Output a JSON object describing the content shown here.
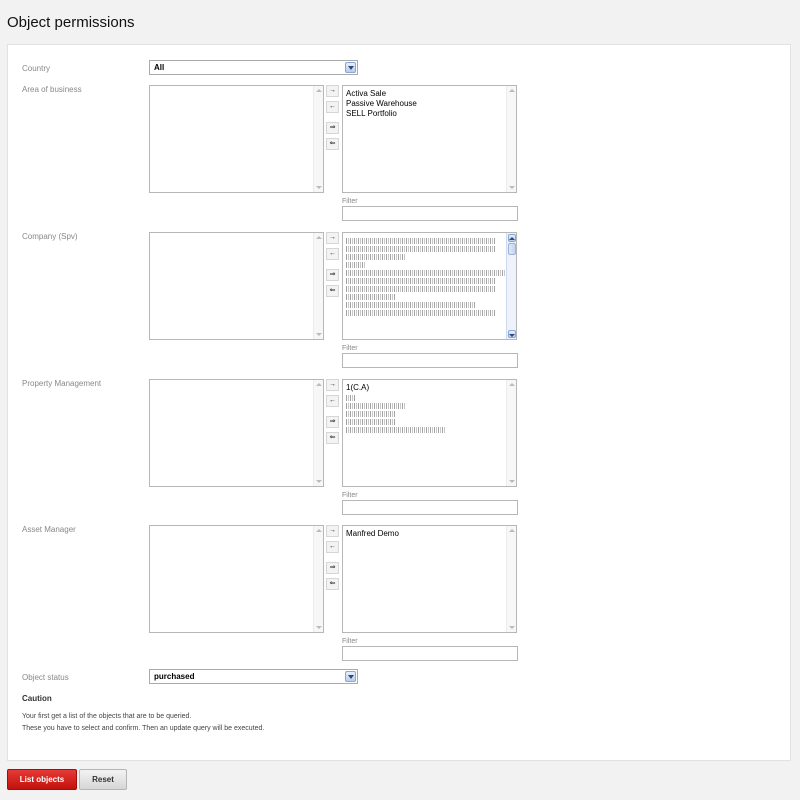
{
  "page": {
    "title": "Object permissions"
  },
  "country": {
    "label": "Country",
    "value": "All"
  },
  "area_of_business": {
    "label": "Area of business",
    "selected": [
      "Activa Sale",
      "Passive Warehouse",
      "SELL Portfolio"
    ],
    "filter_label": "Filter"
  },
  "company": {
    "label": "Company (Spv)",
    "filter_label": "Filter"
  },
  "property_management": {
    "label": "Property Management",
    "first_item": "1(C.A)",
    "filter_label": "Filter"
  },
  "asset_manager": {
    "label": "Asset Manager",
    "selected": [
      "Manfred Demo"
    ],
    "filter_label": "Filter"
  },
  "move_buttons": {
    "add": "→",
    "remove": "←",
    "add_all": "⇒",
    "remove_all": "⇐"
  },
  "object_status": {
    "label": "Object status",
    "value": "purchased"
  },
  "caution": {
    "title": "Caution",
    "line1": "Your first get a list of the objects that are to be queried.",
    "line2": "These you have to select and confirm. Then an update query will be executed."
  },
  "actions": {
    "list_objects": "List objects",
    "reset": "Reset"
  }
}
